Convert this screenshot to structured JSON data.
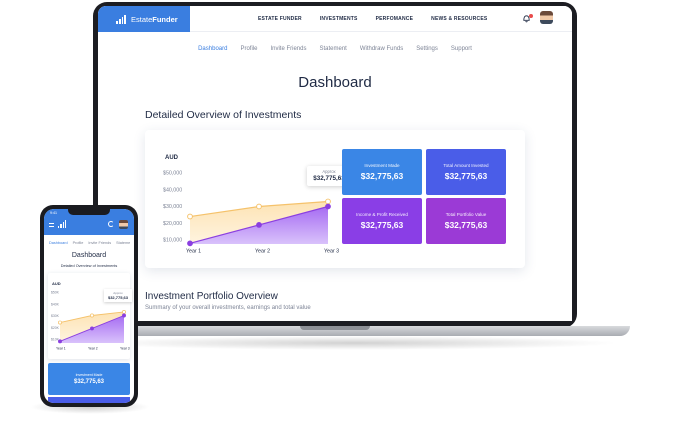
{
  "brand": {
    "name_prefix": "Estate",
    "name_bold": "Funder"
  },
  "top_nav": [
    "ESTATE FUNDER",
    "INVESTMENTS",
    "PERFOMANCE",
    "NEWS & RESOURCES"
  ],
  "sub_nav": [
    {
      "label": "Dashboard",
      "active": true
    },
    {
      "label": "Profile"
    },
    {
      "label": "Invite Friends"
    },
    {
      "label": "Statement"
    },
    {
      "label": "Withdraw Funds"
    },
    {
      "label": "Settings"
    },
    {
      "label": "Support"
    }
  ],
  "page_title": "Dashboard",
  "overview_title": "Detailed Overview of Investments",
  "tooltip": {
    "label": "Approx",
    "value": "$32,775,63"
  },
  "tiles": [
    {
      "label": "Investment Made",
      "value": "$32,775,63",
      "color": "#3a86e6"
    },
    {
      "label": "Total Amount Invested",
      "value": "$32,775,63",
      "color": "#4a5de8"
    },
    {
      "label": "Income & Profit Received",
      "value": "$32,775,63",
      "color": "#8a3ee6"
    },
    {
      "label": "Total Portfolio Value",
      "value": "$32,775,63",
      "color": "#9b3ad6"
    }
  ],
  "portfolio": {
    "title": "Investment Portfolio Overview",
    "subtitle": "Summary of your overall investments, earnings and total value"
  },
  "chart_data": {
    "type": "area",
    "currency": "AUD",
    "categories": [
      "Year 1",
      "Year 2",
      "Year 3"
    ],
    "yticks": [
      "$10,000",
      "$20,000",
      "$30,000",
      "$40,000",
      "$50,000"
    ],
    "ylim": [
      10000,
      50000
    ],
    "series": [
      {
        "values": [
          24000,
          30000,
          33000
        ],
        "color": "#f5c26b"
      },
      {
        "values": [
          8000,
          19000,
          30000
        ],
        "color": "#8b3fe0"
      }
    ]
  },
  "phone": {
    "status_time": "9:41",
    "tabs": [
      {
        "label": "Dashboard",
        "active": true
      },
      {
        "label": "Profile"
      },
      {
        "label": "Invite Friends"
      },
      {
        "label": "Stateme"
      }
    ],
    "title": "Dashboard",
    "subtitle": "Detailed Overview of Investments",
    "chart_currency": "AUD",
    "yticks": [
      "$10K",
      "$20K",
      "$30K",
      "$40K",
      "$50K"
    ],
    "categories": [
      "Year 1",
      "Year 2",
      "Year 3"
    ],
    "tooltip": {
      "label": "Approx",
      "value": "$32,775,63"
    },
    "tile": {
      "label": "Investment Made",
      "value": "$32,775,63"
    }
  },
  "colors": {
    "accent": "#3a7ee0",
    "navy": "#1f2a44",
    "gray": "#7d8496"
  },
  "icons": {
    "bell": "bell-icon",
    "avatar": "avatar",
    "menu": "menu-icon",
    "refresh": "refresh-icon"
  }
}
